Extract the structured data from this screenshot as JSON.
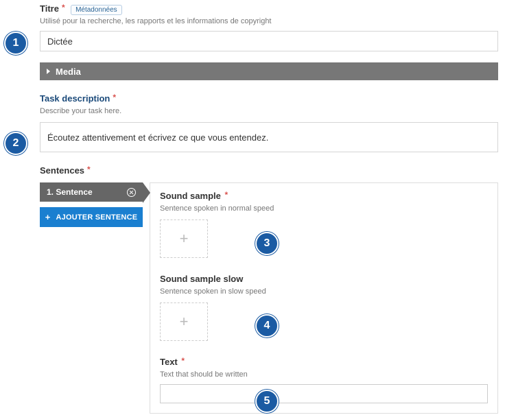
{
  "title_field": {
    "label": "Titre",
    "meta_button": "Métadonnées",
    "help": "Utilisé pour la recherche, les rapports et les informations de copyright",
    "value": "Dictée"
  },
  "media": {
    "label": "Media"
  },
  "task_description": {
    "label": "Task description",
    "help": "Describe your task here.",
    "value": "Écoutez attentivement et écrivez ce que vous entendez."
  },
  "sentences": {
    "label": "Sentences",
    "tab_label": "1. Sentence",
    "add_button": "AJOUTER SENTENCE",
    "sound_sample": {
      "label": "Sound sample",
      "help": "Sentence spoken in normal speed"
    },
    "sound_sample_slow": {
      "label": "Sound sample slow",
      "help": "Sentence spoken in slow speed"
    },
    "text": {
      "label": "Text",
      "help": "Text that should be written",
      "value": ""
    }
  },
  "callouts": [
    "1",
    "2",
    "3",
    "4",
    "5"
  ],
  "asterisk": "*",
  "plus_glyph": "+"
}
